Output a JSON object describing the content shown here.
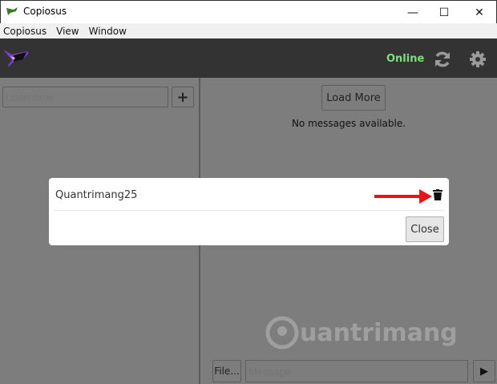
{
  "window": {
    "title": "Copiosus",
    "minimize": "—",
    "maximize": "☐",
    "close": "✕"
  },
  "menu": [
    "Copiosus",
    "View",
    "Window"
  ],
  "header": {
    "status": "Online",
    "status_color": "#7be07b"
  },
  "sidebar": {
    "username_placeholder": "Username",
    "add_label": "+"
  },
  "chat": {
    "load_more": "Load More",
    "empty": "No messages available.",
    "file_label": "File...",
    "message_placeholder": "Message",
    "send_label": "▶"
  },
  "dialog": {
    "contact": "Quantrimang25",
    "close_label": "Close"
  },
  "watermark": "uantrimang"
}
